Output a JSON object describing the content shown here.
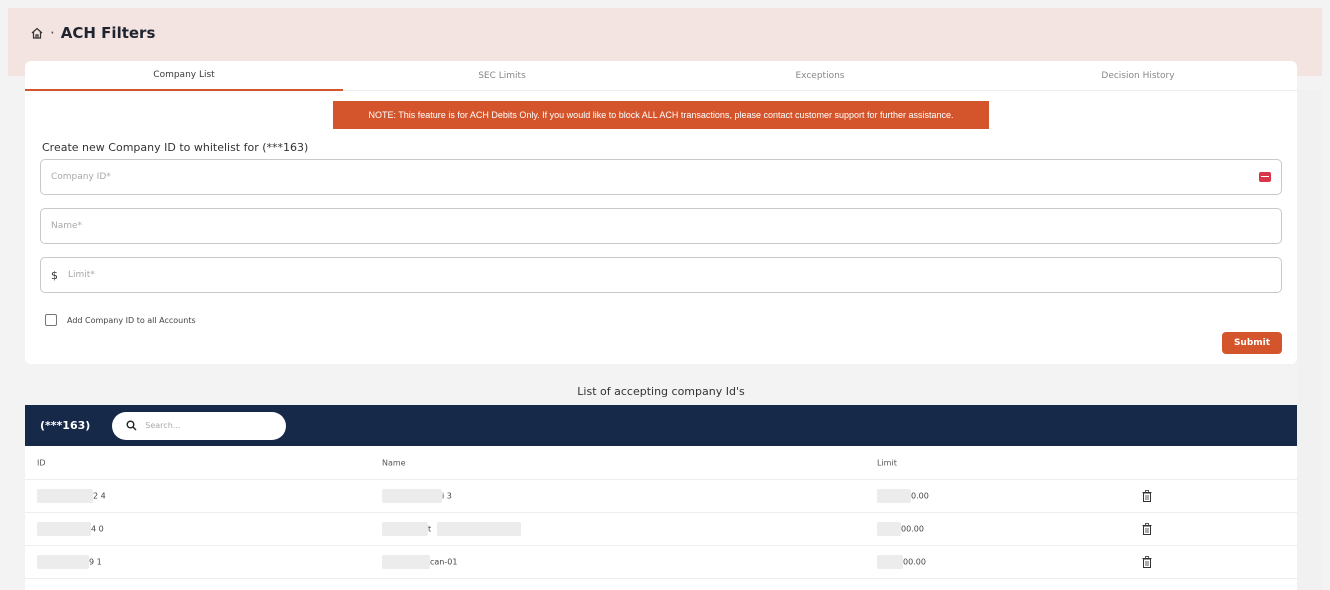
{
  "header": {
    "title": "ACH Filters",
    "separator": "·",
    "home_icon": "home-icon"
  },
  "tabs": [
    {
      "label": "Company List",
      "active": true
    },
    {
      "label": "SEC Limits",
      "active": false
    },
    {
      "label": "Exceptions",
      "active": false
    },
    {
      "label": "Decision History",
      "active": false
    }
  ],
  "note": "NOTE: This feature is for ACH Debits Only. If you would like to block ALL ACH transactions, please contact customer support for further assistance.",
  "form": {
    "heading": "Create new Company ID to whitelist for (***163)",
    "company_id_placeholder": "Company ID*",
    "name_placeholder": "Name*",
    "limit_placeholder": "Limit*",
    "currency_symbol": "$",
    "checkbox_label": "Add Company ID to all Accounts",
    "submit_label": "Submit"
  },
  "list": {
    "title": "List of accepting company Id's",
    "account_label": "(***163)",
    "search_placeholder": "Search...",
    "columns": [
      "ID",
      "Name",
      "Limit"
    ],
    "rows": [
      {
        "id": "2 4",
        "name": "i 3",
        "limit": "0.00"
      },
      {
        "id": "4 0",
        "name": "t",
        "limit": "00.00"
      },
      {
        "id": "9 1",
        "name": "can-01",
        "limit": "00.00"
      }
    ]
  },
  "colors": {
    "accent": "#d4552b",
    "navy": "#172949",
    "header_band": "#f3e3e1"
  }
}
